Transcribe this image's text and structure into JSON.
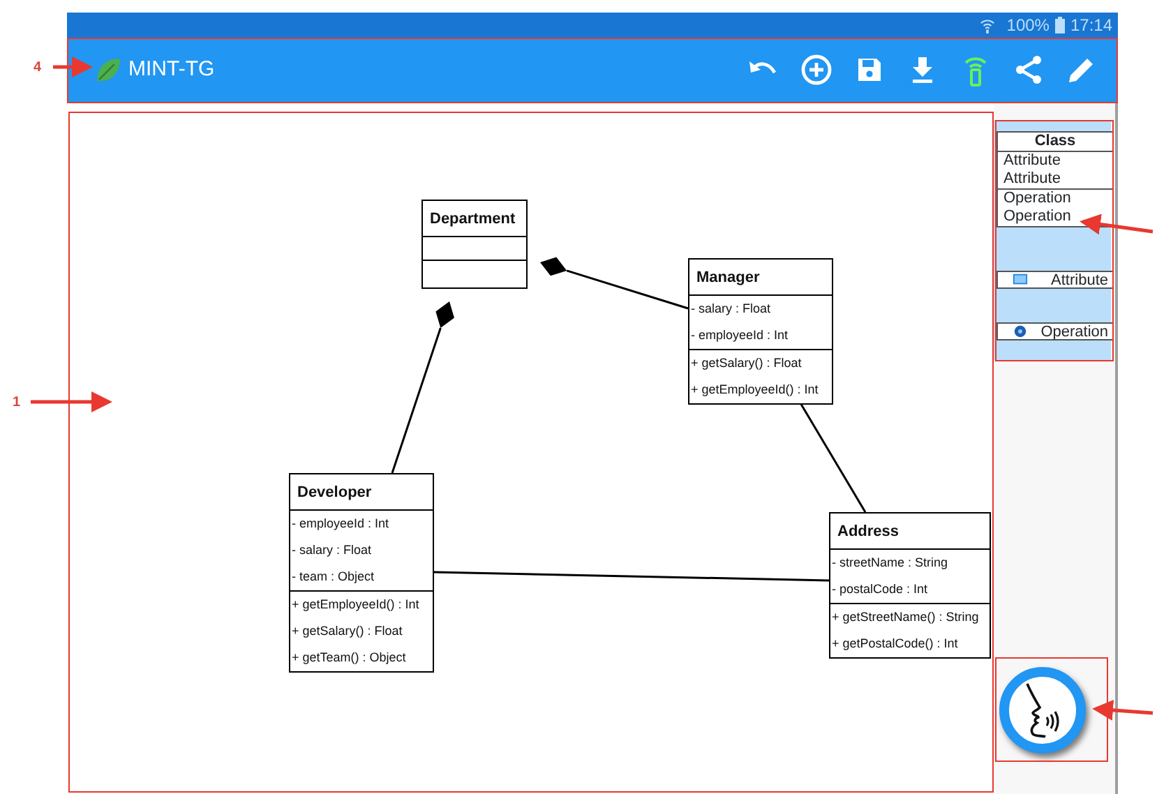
{
  "status_bar": {
    "battery": "100%",
    "time": "17:14"
  },
  "app_bar": {
    "title": "MINT-TG",
    "actions": [
      {
        "kind": "undo"
      },
      {
        "kind": "add"
      },
      {
        "kind": "save"
      },
      {
        "kind": "download"
      },
      {
        "kind": "remote"
      },
      {
        "kind": "share"
      },
      {
        "kind": "edit"
      }
    ]
  },
  "diagram": {
    "classes": [
      {
        "name": "Department"
      },
      {
        "name": "Manager",
        "attributes": [
          "- salary : Float",
          "- employeeId : Int"
        ],
        "operations": [
          "+ getSalary() : Float",
          "+ getEmployeeId() : Int"
        ]
      },
      {
        "name": "Developer",
        "attributes": [
          "- employeeId : Int",
          "- salary : Float",
          "- team : Object"
        ],
        "operations": [
          "+ getEmployeeId() : Int",
          "+ getSalary() : Float",
          "+ getTeam() : Object"
        ]
      },
      {
        "name": "Address",
        "attributes": [
          "- streetName : String",
          "- postalCode : Int"
        ],
        "operations": [
          "+ getStreetName() : String",
          "+ getPostalCode() : Int"
        ]
      }
    ],
    "links": [
      {
        "kind": "composition"
      },
      {
        "kind": "composition"
      },
      {
        "kind": "association"
      },
      {
        "kind": "association"
      }
    ]
  },
  "palette": {
    "class_template": {
      "name": "Class",
      "attributes": [
        "Attribute",
        "Attribute"
      ],
      "operations": [
        "Operation",
        "Operation"
      ]
    },
    "items": [
      {
        "kind": "attribute",
        "label": "Attribute"
      },
      {
        "kind": "operation",
        "label": "Operation"
      }
    ]
  },
  "callouts": [
    {
      "label": "4"
    },
    {
      "label": "1"
    }
  ]
}
